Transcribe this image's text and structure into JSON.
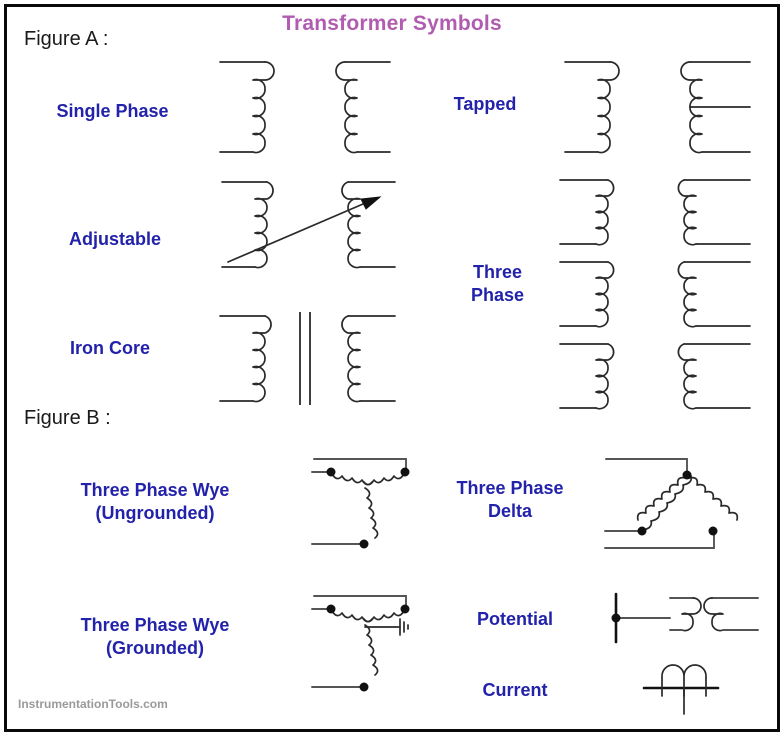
{
  "page": {
    "title": "Transformer Symbols",
    "title_color": "#b05cb0",
    "label_color": "#2222aa",
    "border_color": "#0a0a0a",
    "watermark": "InstrumentationTools.com"
  },
  "figures": [
    {
      "key": "a",
      "heading": "Figure A :"
    },
    {
      "key": "b",
      "heading": "Figure B :"
    }
  ],
  "figure_a": {
    "symbols": [
      {
        "name": "single-phase",
        "label": "Single Phase",
        "loops": 5,
        "feature": "plain two-winding"
      },
      {
        "name": "tapped",
        "label": "Tapped",
        "loops": 5,
        "feature": "center tap lead on secondary"
      },
      {
        "name": "adjustable",
        "label": "Adjustable",
        "loops": 5,
        "feature": "diagonal arrow across windings"
      },
      {
        "name": "iron-core",
        "label": "Iron Core",
        "loops": 5,
        "feature": "two vertical core lines"
      },
      {
        "name": "three-phase",
        "label_line1": "Three",
        "label_line2": "Phase",
        "label": "Three Phase",
        "loops": 4,
        "stacks": 3,
        "feature": "three stacked two-winding sets"
      }
    ]
  },
  "figure_b": {
    "symbols": [
      {
        "name": "three-phase-wye-ungrounded",
        "label_line1": "Three Phase Wye",
        "label_line2": "(Ungrounded)",
        "label": "Three Phase Wye (Ungrounded)",
        "terminals": 3,
        "feature": "star of three coils, no ground"
      },
      {
        "name": "three-phase-delta",
        "label_line1": "Three Phase",
        "label_line2": "Delta",
        "label": "Three Phase Delta",
        "terminals": 3,
        "feature": "triangular loop of three coils"
      },
      {
        "name": "three-phase-wye-grounded",
        "label_line1": "Three Phase Wye",
        "label_line2": "(Grounded)",
        "label": "Three Phase Wye (Grounded)",
        "terminals": 3,
        "feature": "star of three coils with ground at neutral"
      },
      {
        "name": "potential-transformer",
        "label": "Potential",
        "feature": "bus line with dot feeding two-winding symbol"
      },
      {
        "name": "current-transformer",
        "label": "Current",
        "feature": "conductor through two-loop winding"
      }
    ]
  }
}
